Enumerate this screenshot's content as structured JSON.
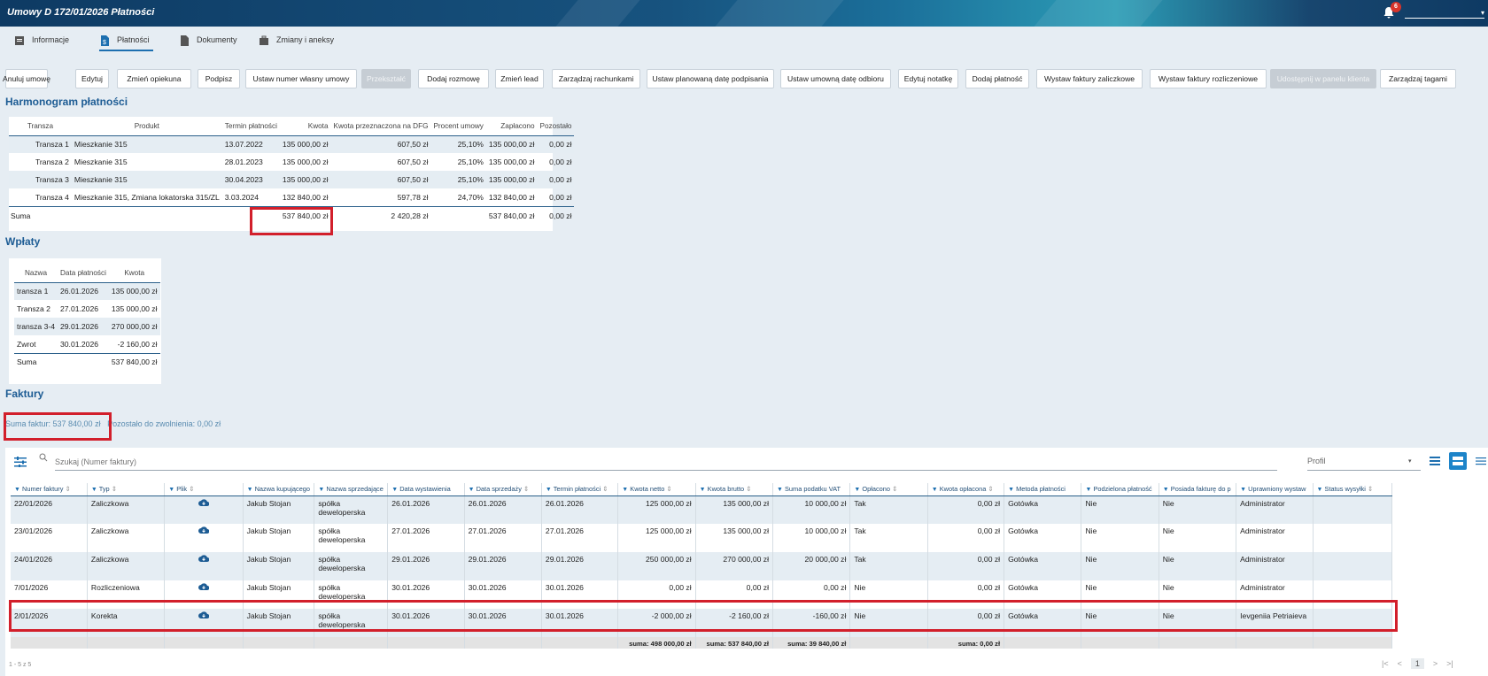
{
  "window": {
    "title": "Umowy  D 172/01/2026  Płatności",
    "notification_count": "6"
  },
  "tabs": [
    {
      "label": "Informacje",
      "icon": "document-icon"
    },
    {
      "label": "Płatności",
      "icon": "payment-document-icon"
    },
    {
      "label": "Dokumenty",
      "icon": "file-icon"
    },
    {
      "label": "Zmiany i aneksy",
      "icon": "briefcase-icon"
    }
  ],
  "buttons": [
    "Anuluj umowę",
    "Edytuj",
    "Zmień opiekuna",
    "Podpisz",
    "Ustaw numer własny umowy",
    "Przekształć",
    "Dodaj rozmowę",
    "Zmień lead",
    "Zarządzaj rachunkami",
    "Ustaw planowaną datę podpisania",
    "Ustaw umowną datę odbioru",
    "Edytuj notatkę",
    "Dodaj płatność",
    "Wystaw faktury zaliczkowe",
    "Wystaw faktury rozliczeniowe",
    "Udostępnij w panelu klienta",
    "Zarządzaj tagami"
  ],
  "harmonogram": {
    "title": "Harmonogram płatności",
    "headers": [
      "Transza",
      "Produkt",
      "Termin płatności",
      "Kwota",
      "Kwota przeznaczona na DFG",
      "Procent umowy",
      "Zapłacono",
      "Pozostało"
    ],
    "rows": [
      [
        "Transza 1",
        "Mieszkanie 315",
        "13.07.2022",
        "135 000,00 zł",
        "607,50 zł",
        "25,10%",
        "135 000,00 zł",
        "0,00 zł"
      ],
      [
        "Transza 2",
        "Mieszkanie 315",
        "28.01.2023",
        "135 000,00 zł",
        "607,50 zł",
        "25,10%",
        "135 000,00 zł",
        "0,00 zł"
      ],
      [
        "Transza 3",
        "Mieszkanie 315",
        "30.04.2023",
        "135 000,00 zł",
        "607,50 zł",
        "25,10%",
        "135 000,00 zł",
        "0,00 zł"
      ],
      [
        "Transza 4",
        "Mieszkanie 315, Zmiana lokatorska 315/ZL",
        "3.03.2024",
        "132 840,00 zł",
        "597,78 zł",
        "24,70%",
        "132 840,00 zł",
        "0,00 zł"
      ]
    ],
    "sum": {
      "label": "Suma",
      "kwota": "537 840,00 zł",
      "dfg": "2 420,28 zł",
      "zaplacono": "537 840,00 zł",
      "pozostalo": "0,00 zł"
    }
  },
  "wplaty": {
    "title": "Wpłaty",
    "headers": [
      "Nazwa",
      "Data płatności",
      "Kwota"
    ],
    "rows": [
      [
        "transza 1",
        "26.01.2026",
        "135 000,00 zł"
      ],
      [
        "Transza 2",
        "27.01.2026",
        "135 000,00 zł"
      ],
      [
        "transza 3-4",
        "29.01.2026",
        "270 000,00 zł"
      ],
      [
        "Zwrot",
        "30.01.2026",
        "-2 160,00 zł"
      ]
    ],
    "sum": {
      "label": "Suma",
      "kwota": "537 840,00 zł"
    }
  },
  "faktury": {
    "title": "Faktury",
    "suma_label": "Suma faktur: 537 840,00 zł",
    "pozostalo_label": "Pozostało do zwolnienia: 0,00 zł",
    "search_placeholder": "Szukaj (Numer faktury)",
    "profile_placeholder": "Profil",
    "headers": [
      "Numer faktury",
      "Typ",
      "Plik",
      "Nazwa kupującego",
      "Nazwa sprzedające",
      "Data wystawienia",
      "Data sprzedaży",
      "Termin płatności",
      "Kwota netto",
      "Kwota brutto",
      "Suma podatku VAT",
      "Opłacono",
      "Kwota opłacona",
      "Metoda płatności",
      "Podzielona płatność",
      "Posiada fakturę do p",
      "Uprawniony wystaw",
      "Status wysyłki"
    ],
    "rows": [
      [
        "22/01/2026",
        "Zaliczkowa",
        "",
        "Jakub Stojan",
        "spółka deweloperska",
        "26.01.2026",
        "26.01.2026",
        "26.01.2026",
        "125 000,00 zł",
        "135 000,00 zł",
        "10 000,00 zł",
        "Tak",
        "0,00 zł",
        "Gotówka",
        "Nie",
        "Nie",
        "Administrator",
        ""
      ],
      [
        "23/01/2026",
        "Zaliczkowa",
        "",
        "Jakub Stojan",
        "spółka deweloperska",
        "27.01.2026",
        "27.01.2026",
        "27.01.2026",
        "125 000,00 zł",
        "135 000,00 zł",
        "10 000,00 zł",
        "Tak",
        "0,00 zł",
        "Gotówka",
        "Nie",
        "Nie",
        "Administrator",
        ""
      ],
      [
        "24/01/2026",
        "Zaliczkowa",
        "",
        "Jakub Stojan",
        "spółka deweloperska",
        "29.01.2026",
        "29.01.2026",
        "29.01.2026",
        "250 000,00 zł",
        "270 000,00 zł",
        "20 000,00 zł",
        "Tak",
        "0,00 zł",
        "Gotówka",
        "Nie",
        "Nie",
        "Administrator",
        ""
      ],
      [
        "7/01/2026",
        "Rozliczeniowa",
        "",
        "Jakub Stojan",
        "spółka deweloperska",
        "30.01.2026",
        "30.01.2026",
        "30.01.2026",
        "0,00 zł",
        "0,00 zł",
        "0,00 zł",
        "Nie",
        "0,00 zł",
        "Gotówka",
        "Nie",
        "Nie",
        "Administrator",
        ""
      ],
      [
        "2/01/2026",
        "Korekta",
        "",
        "Jakub Stojan",
        "spółka deweloperska",
        "30.01.2026",
        "30.01.2026",
        "30.01.2026",
        "-2 000,00 zł",
        "-2 160,00 zł",
        "-160,00 zł",
        "Nie",
        "0,00 zł",
        "Gotówka",
        "Nie",
        "Nie",
        "Ievgeniia Petriaieva",
        ""
      ]
    ],
    "sums": {
      "netto": "suma: 498 000,00 zł",
      "brutto": "suma: 537 840,00 zł",
      "vat": "suma: 39 840,00 zł",
      "oplacona": "suma: 0,00 zł"
    },
    "pager_info": "1 - 5 z 5",
    "current_page": "1"
  },
  "colors": {
    "accent": "#1d6fb0",
    "highlight": "#d21f2b",
    "section_title": "#1d5c94"
  }
}
